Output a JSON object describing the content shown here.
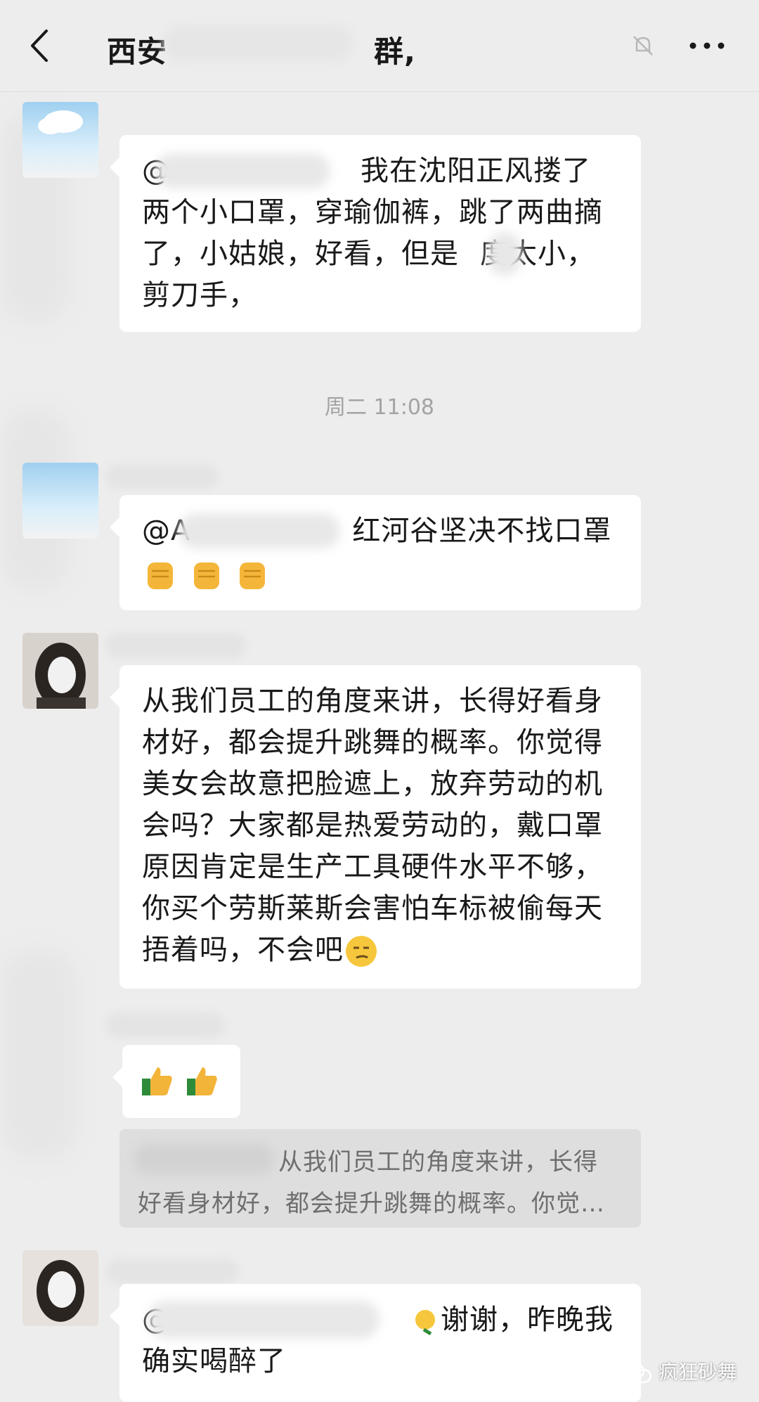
{
  "header": {
    "title_start": "西安",
    "title_end": "群,"
  },
  "messages": [
    {
      "text_visible": "我在沈阳正风搂了两个小口罩，穿瑜伽裤，跳了两曲摘了，小姑娘，好看，但是",
      "text_tail": "度太小，剪刀手，",
      "mention_prefix": "@"
    },
    {
      "mention_prefix": "@A",
      "text_visible": "红河谷坚决不找口罩"
    },
    {
      "text_visible": "从我们员工的角度来讲，长得好看身材好，都会提升跳舞的概率。你觉得美女会故意把脸遮上，放弃劳动的机会吗？大家都是热爱劳动的，戴口罩原因肯定是生产工具硬件水平不够，你买个劳斯莱斯会害怕车标被偷每天捂着吗，不会吧"
    },
    {
      "text_visible": ""
    },
    {
      "mention_prefix": "@",
      "text_visible": "谢谢，昨晚我确实喝醉了"
    }
  ],
  "timestamp": "周二 11:08",
  "quote": {
    "text_line1": "从我们员工的角度来讲，长得",
    "text_line2": "好看身材好，都会提升跳舞的概率。你觉…"
  },
  "icons": {
    "back": "back-arrow-icon",
    "mute": "mute-bell-icon",
    "more": "more-dots-icon",
    "fist": "raised-fist-emoji",
    "thumbs": "thumbs-up-emoji",
    "smirk": "smirk-emoji",
    "cry": "crying-laugh-emoji"
  },
  "watermark": "疯狂砂舞",
  "colors": {
    "background": "#ededed",
    "bubble": "#ffffff",
    "quote_bg": "#dedede",
    "time": "#a3a3a3"
  }
}
